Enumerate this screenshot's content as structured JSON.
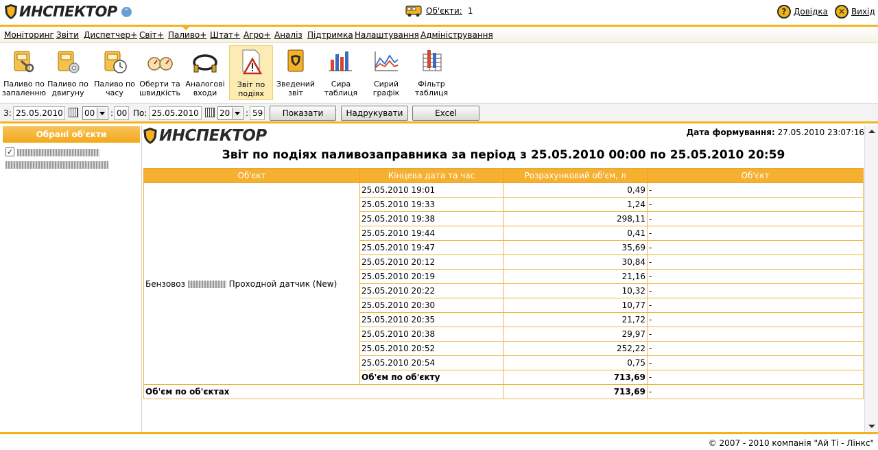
{
  "app": {
    "logo_text": "ИНСПЕКТОР"
  },
  "header": {
    "objects_label": "Об'єкти:",
    "objects_count": "1",
    "help_label": "Довідка",
    "exit_label": "Вихід"
  },
  "menu": {
    "items": [
      "Моніторинг",
      "Звіти",
      "Диспетчер+",
      "Світ+",
      "Паливо+",
      "Штат+",
      "Агро+",
      "Аналіз",
      "Підтримка",
      "Налаштування",
      "Адміністрування"
    ]
  },
  "toolbar": {
    "tools": [
      {
        "line1": "Паливо по",
        "line2": "запаленню",
        "icon": "fuel-key-icon"
      },
      {
        "line1": "Паливо по",
        "line2": "двигуну",
        "icon": "fuel-engine-icon"
      },
      {
        "line1": "Паливо по",
        "line2": "часу",
        "icon": "fuel-clock-icon"
      },
      {
        "line1": "Оберти та",
        "line2": "швидкість",
        "icon": "gauges-icon"
      },
      {
        "line1": "Аналогові",
        "line2": "входи",
        "icon": "cable-icon"
      },
      {
        "line1": "Звіт по",
        "line2": "подіях",
        "icon": "warning-doc-icon"
      },
      {
        "line1": "Зведений",
        "line2": "звіт",
        "icon": "book-icon"
      },
      {
        "line1": "Сира",
        "line2": "таблиця",
        "icon": "bar-chart-icon"
      },
      {
        "line1": "Сирий",
        "line2": "графік",
        "icon": "line-chart-icon"
      },
      {
        "line1": "Фільтр",
        "line2": "таблиця",
        "icon": "filter-table-icon"
      }
    ]
  },
  "filter": {
    "from_label": "З:",
    "from_date": "25.05.2010",
    "from_hour": "00",
    "from_min": "00",
    "to_label": "По:",
    "to_date": "25.05.2010",
    "to_hour": "20",
    "to_min": "59",
    "colon": ":",
    "show_button": "Показати",
    "print_button": "Надрукувати",
    "excel_button": "Excel"
  },
  "left_panel": {
    "title": "Обрані об'єкти",
    "check_mark": "✓"
  },
  "report": {
    "gen_label": "Дата формування:",
    "gen_value": "27.05.2010 23:07:16",
    "title": "Звіт по подіях паливозаправника за період з 25.05.2010 00:00 по 25.05.2010 20:59",
    "columns": [
      "Об'єкт",
      "Кінцева дата та час",
      "Розрахунковий об'єм, л",
      "Об'єкт"
    ],
    "object_prefix": "Бензовоз",
    "object_suffix": "Проходной датчик (New)",
    "rows": [
      {
        "date": "25.05.2010 19:01",
        "volume": "0,49",
        "note": "-"
      },
      {
        "date": "25.05.2010 19:33",
        "volume": "1,24",
        "note": "-"
      },
      {
        "date": "25.05.2010 19:38",
        "volume": "298,11",
        "note": "-"
      },
      {
        "date": "25.05.2010 19:44",
        "volume": "0,41",
        "note": "-"
      },
      {
        "date": "25.05.2010 19:47",
        "volume": "35,69",
        "note": "-"
      },
      {
        "date": "25.05.2010 20:12",
        "volume": "30,84",
        "note": "-"
      },
      {
        "date": "25.05.2010 20:19",
        "volume": "21,16",
        "note": "-"
      },
      {
        "date": "25.05.2010 20:22",
        "volume": "10,32",
        "note": "-"
      },
      {
        "date": "25.05.2010 20:30",
        "volume": "10,77",
        "note": "-"
      },
      {
        "date": "25.05.2010 20:35",
        "volume": "21,72",
        "note": "-"
      },
      {
        "date": "25.05.2010 20:38",
        "volume": "29,97",
        "note": "-"
      },
      {
        "date": "25.05.2010 20:52",
        "volume": "252,22",
        "note": "-"
      },
      {
        "date": "25.05.2010 20:54",
        "volume": "0,75",
        "note": "-"
      }
    ],
    "subtotal_label": "Об'єм по об'єкту",
    "subtotal_value": "713,69",
    "subtotal_note": "-",
    "total_label": "Об'єм по об'єктах",
    "total_value": "713,69",
    "total_note": "-"
  },
  "footer": {
    "copyright": "© 2007 - 2010 компанія \"Ай Ті - Лінкс\""
  },
  "colors": {
    "accent": "#f6b21b",
    "header_cell": "#f6b030",
    "active_tool": "#fdebb4"
  }
}
